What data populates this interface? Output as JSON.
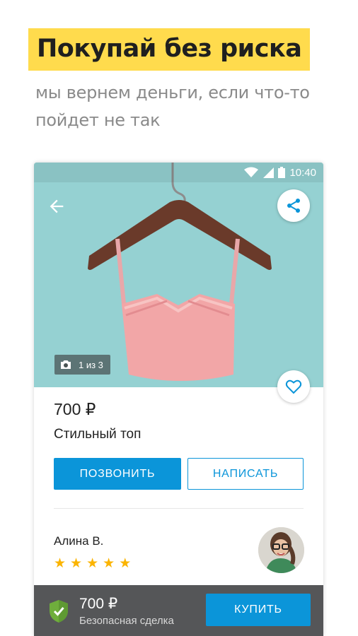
{
  "promo": {
    "headline": "Покупай без риска",
    "subtitle": "мы вернем деньги, если что-то пойдет не так"
  },
  "statusbar": {
    "time": "10:40"
  },
  "photo": {
    "counter": "1 из 3"
  },
  "listing": {
    "price": "700 ₽",
    "title": "Стильный топ"
  },
  "actions": {
    "call_label": "ПОЗВОНИТЬ",
    "write_label": "НАПИСАТЬ"
  },
  "seller": {
    "name": "Алина В.",
    "rating": 5
  },
  "bottom_bar": {
    "price": "700 ₽",
    "label": "Безопасная сделка",
    "buy_label": "КУПИТЬ"
  },
  "icons": [
    "wifi-icon",
    "signal-icon",
    "battery-icon",
    "back-arrow-icon",
    "share-icon",
    "camera-icon",
    "heart-icon",
    "star-icon",
    "shield-check-icon"
  ],
  "colors": {
    "accent_yellow": "#ffdb4d",
    "primary_blue": "#0b95d9",
    "bottom_bar": "#555658",
    "photo_bg": "#95d1d2",
    "star": "#fbb400",
    "shield": "#6fae3c"
  }
}
